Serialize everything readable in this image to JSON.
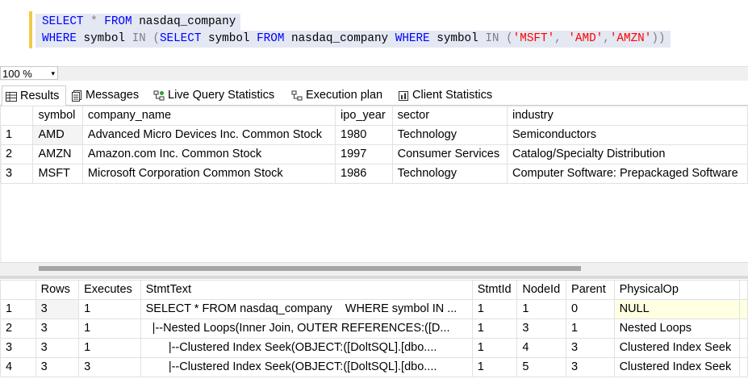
{
  "editor": {
    "line1": {
      "select": "SELECT",
      "star": "*",
      "from": "FROM",
      "table": "nasdaq_company"
    },
    "line2": {
      "where": "WHERE",
      "col": "symbol",
      "in": "IN",
      "open": "(",
      "select": "SELECT",
      "col2": "symbol",
      "from": "FROM",
      "table": "nasdaq_company",
      "where2": "WHERE",
      "col3": "symbol",
      "in2": "IN",
      "open2": "(",
      "v1": "'MSFT'",
      "c1": ",",
      "v2": "'AMD'",
      "c2": ",",
      "v3": "'AMZN'",
      "close": "))"
    }
  },
  "zoom": {
    "value": "100 %",
    "arrow": "▾"
  },
  "tabs": {
    "results": "Results",
    "messages": "Messages",
    "live": "Live Query Statistics",
    "plan": "Execution plan",
    "client": "Client Statistics"
  },
  "results": {
    "headers": [
      "symbol",
      "company_name",
      "ipo_year",
      "sector",
      "industry"
    ],
    "rows": [
      {
        "n": "1",
        "symbol": "AMD",
        "company_name": "Advanced Micro Devices Inc. Common Stock",
        "ipo_year": "1980",
        "sector": "Technology",
        "industry": "Semiconductors"
      },
      {
        "n": "2",
        "symbol": "AMZN",
        "company_name": "Amazon.com Inc. Common Stock",
        "ipo_year": "1997",
        "sector": "Consumer Services",
        "industry": "Catalog/Specialty Distribution"
      },
      {
        "n": "3",
        "symbol": "MSFT",
        "company_name": "Microsoft Corporation Common Stock",
        "ipo_year": "1986",
        "sector": "Technology",
        "industry": "Computer Software: Prepackaged Software"
      }
    ]
  },
  "stats": {
    "headers": [
      "Rows",
      "Executes",
      "StmtText",
      "StmtId",
      "NodeId",
      "Parent",
      "PhysicalOp"
    ],
    "rows": [
      {
        "n": "1",
        "rows": "3",
        "executes": "1",
        "stmt": "SELECT * FROM nasdaq_company    WHERE symbol IN ...",
        "stmtid": "1",
        "nodeid": "1",
        "parent": "0",
        "op": "NULL"
      },
      {
        "n": "2",
        "rows": "3",
        "executes": "1",
        "stmt": "  |--Nested Loops(Inner Join, OUTER REFERENCES:([D...",
        "stmtid": "1",
        "nodeid": "3",
        "parent": "1",
        "op": "Nested Loops"
      },
      {
        "n": "3",
        "rows": "3",
        "executes": "1",
        "stmt": "       |--Clustered Index Seek(OBJECT:([DoltSQL].[dbo....",
        "stmtid": "1",
        "nodeid": "4",
        "parent": "3",
        "op": "Clustered Index Seek"
      },
      {
        "n": "4",
        "rows": "3",
        "executes": "3",
        "stmt": "       |--Clustered Index Seek(OBJECT:([DoltSQL].[dbo....",
        "stmtid": "1",
        "nodeid": "5",
        "parent": "3",
        "op": "Clustered Index Seek"
      }
    ]
  }
}
